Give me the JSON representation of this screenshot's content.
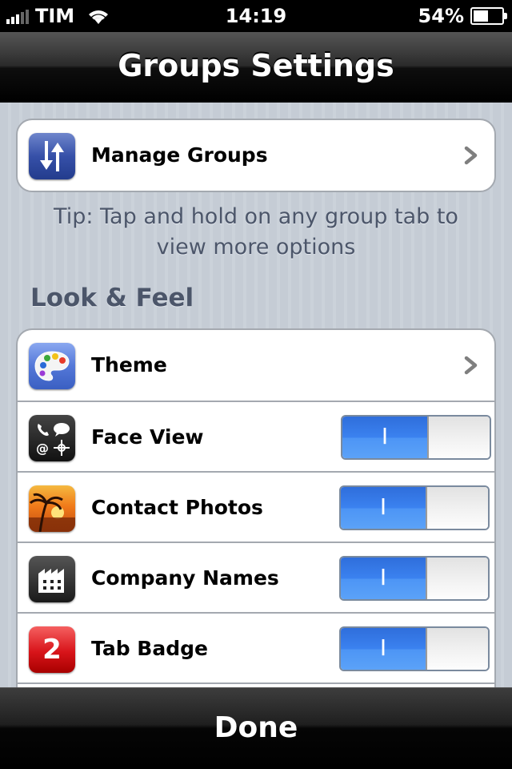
{
  "status_bar": {
    "carrier": "TIM",
    "time": "14:19",
    "battery_percent": "54%",
    "battery_level": 0.54,
    "signal_bars": 3
  },
  "nav": {
    "title": "Groups Settings"
  },
  "manage": {
    "label": "Manage Groups",
    "icon": "up-down-arrows-icon"
  },
  "tip": "Tip: Tap and hold on any group tab to view more options",
  "look_and_feel": {
    "header": "Look & Feel",
    "rows": [
      {
        "label": "Theme",
        "icon": "palette-icon",
        "control": "chevron"
      },
      {
        "label": "Face View",
        "icon": "contact-methods-icon",
        "control": "switch",
        "on": true,
        "on_text": "I"
      },
      {
        "label": "Contact Photos",
        "icon": "sunset-photo-icon",
        "control": "switch",
        "on": true,
        "on_text": "I"
      },
      {
        "label": "Company Names",
        "icon": "building-icon",
        "control": "switch",
        "on": true,
        "on_text": "I"
      },
      {
        "label": "Tab Badge",
        "icon": "badge-number-icon",
        "badge_number": "2",
        "control": "switch",
        "on": true,
        "on_text": "I"
      }
    ]
  },
  "done": {
    "label": "Done"
  },
  "colors": {
    "switch_on": "#3b82f0",
    "background": "#c5ccd5",
    "section_text": "#4c566a"
  }
}
